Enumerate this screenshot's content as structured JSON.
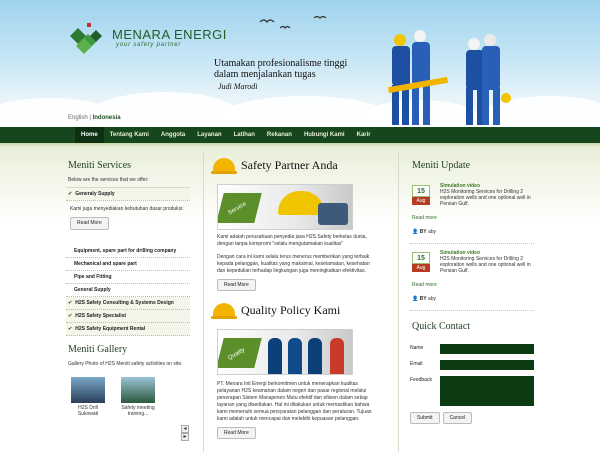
{
  "brand": {
    "name": "MENARA ENERGI",
    "tagline": "your safety partner",
    "colors": {
      "primary": "#16461d",
      "accent": "#f3b400",
      "date_red": "#b73b22"
    }
  },
  "header": {
    "slogan": "Utamakan profesionalisme tinggi dalam menjalankan tugas",
    "signature": "Judi Marodi",
    "lang_en": "English",
    "lang_sep": " | ",
    "lang_id": "Indonesia"
  },
  "nav": {
    "items": [
      "Home",
      "Tentang Kami",
      "Anggota",
      "Layanan",
      "Latihan",
      "Rekanan",
      "Hubungi Kami",
      "Karir"
    ],
    "active": "Home"
  },
  "left": {
    "title": "Meniti Services",
    "intro": "Below are the services that we offer:",
    "general_supply": "Generaly Supply",
    "general_supply_body": "Kami juga menyediakan kebutuhan dasar produksi:",
    "read_more": "Read More",
    "subitems": [
      "Equipment, spare part for drilling company",
      "Mechanical and spare part",
      "Pipe and Fitting",
      "General Supply"
    ],
    "services": [
      "H2S Safety Consulting & Systems Design",
      "H2S Safety Specialist",
      "H2S Safety Equipment Rental"
    ],
    "gallery_title": "Meniti Gallery",
    "gallery_intro": "Gallery Photo of H2S Meniti safety activities on site.",
    "gallery": [
      {
        "caption": "H2S Drill Sukowati"
      },
      {
        "caption": "Safety meeting training..."
      }
    ],
    "arrow_prev": "◂",
    "arrow_next": "▸"
  },
  "middle": {
    "s1_title": "Safety Partner Anda",
    "s1_badge": "Service",
    "s1_p1": "Kami adalah perusahaan penyedia jasa H2S Safety berkelas dunia, dengan tanpa kompromi \"selalu mengutamakan kualitas\"",
    "s1_p2": "Dengan cara ini kami selalu terus menerus memberikan yang terbaik kepada pelanggan, kualitas yang maksimal, keselamatan, kesehatan dan kepedulian terhadap lingkungan juga meningkatkan efektivitas.",
    "read_more": "Read More",
    "s2_title": "Quality Policy Kami",
    "s2_badge": "Quality",
    "s2_p1": "PT. Menara Inti Energi berkomitmen untuk menerapkan kualitas pelayanan H2S keamanan dalam negeri dan pasar regional melalui penerapan Sistem Manajemen Mutu efektif dan efisien dalam setiap layanan yang disediakan. Hal ini dilakukan untuk memastikan bahwa kami memenuhi semua persyaratan pelanggan dan peraturan. Tujuan kami adalah untuk mencapai dan melebihi kepuasan pelanggan."
  },
  "right": {
    "title": "Meniti Update",
    "news": [
      {
        "day": "15",
        "month": "Aug",
        "title": "Simulation video",
        "text": "H2S Monitoring Services for Drilling 2 exploration wells and one optional well in Persian Gulf.",
        "more": "Read more",
        "by": "BY",
        "author": "aby"
      },
      {
        "day": "15",
        "month": "Aug",
        "title": "Simulation video",
        "text": "H2S Monitoring Services for Drilling 2 exploration wells and one optional well in Persian Gulf.",
        "more": "Read more",
        "by": "BY",
        "author": "aby"
      }
    ],
    "contact_title": "Quick Contact",
    "name_label": "Name",
    "email_label": "Email",
    "feedback_label": "Feedback",
    "submit": "Submit",
    "cancel": "Cancel"
  }
}
